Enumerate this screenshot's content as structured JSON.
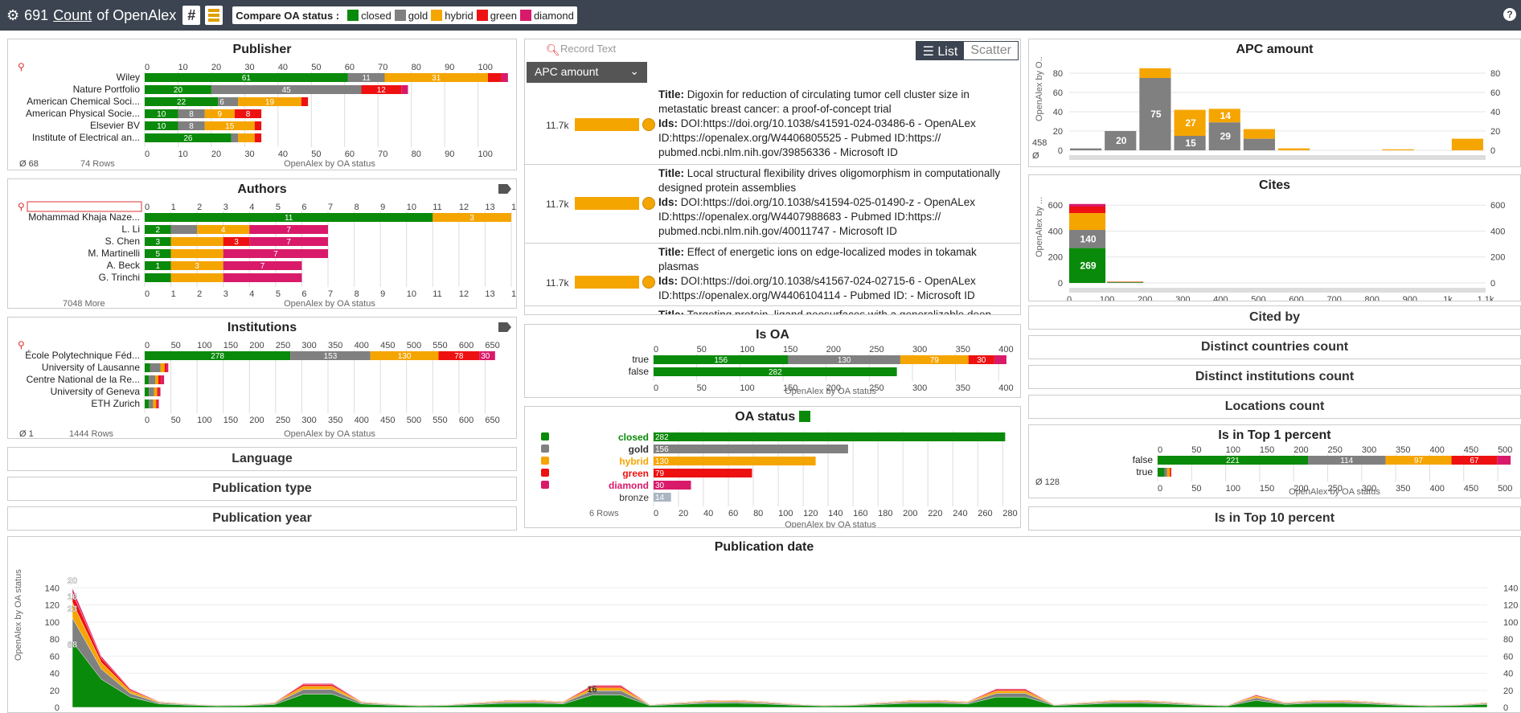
{
  "colors": {
    "closed": "#0a8a0a",
    "gold": "#808080",
    "hybrid": "#f5a500",
    "green": "#ee1111",
    "diamond": "#d91a6a",
    "bronze": "#aab4c2",
    "header": "#3b4450"
  },
  "topbar": {
    "count": "691",
    "count_label": "Count",
    "of_label": "of OpenAlex",
    "compare_label": "Compare OA status :",
    "legend": [
      "closed",
      "gold",
      "hybrid",
      "green",
      "diamond"
    ],
    "hash": "#"
  },
  "publisher": {
    "title": "Publisher",
    "ticks": [
      0,
      10,
      20,
      30,
      40,
      50,
      60,
      70,
      80,
      90,
      100
    ],
    "max": 110,
    "rows": [
      {
        "name": "Wiley",
        "segs": [
          61,
          11,
          31,
          4,
          2
        ]
      },
      {
        "name": "Nature Portfolio",
        "segs": [
          20,
          45,
          0,
          12,
          2
        ]
      },
      {
        "name": "American Chemical Soci...",
        "segs": [
          22,
          6,
          19,
          2,
          0
        ]
      },
      {
        "name": "American Physical Socie...",
        "segs": [
          10,
          8,
          9,
          8,
          0
        ]
      },
      {
        "name": "Elsevier BV",
        "segs": [
          10,
          8,
          15,
          2,
          0
        ]
      },
      {
        "name": "Institute of Electrical an...",
        "segs": [
          26,
          2,
          5,
          2,
          0
        ]
      }
    ],
    "footer_null": "68",
    "footer_rows": "74 Rows",
    "axis_note": "OpenAlex by OA status"
  },
  "authors": {
    "title": "Authors",
    "ticks": [
      0,
      1,
      2,
      3,
      4,
      5,
      6,
      7,
      8,
      9,
      10,
      11,
      12,
      13,
      14
    ],
    "max": 14,
    "rows": [
      {
        "name": "Mohammad Khaja Naze...",
        "segs": [
          11,
          0,
          3,
          0,
          0
        ]
      },
      {
        "name": "L. Li",
        "segs": [
          1,
          1,
          2,
          0,
          3
        ]
      },
      {
        "name": "S. Chen",
        "segs": [
          1,
          0,
          2,
          1,
          3
        ]
      },
      {
        "name": "M. Martinelli",
        "segs": [
          1,
          0,
          2,
          0,
          4
        ]
      },
      {
        "name": "A. Beck",
        "segs": [
          1,
          0,
          2,
          0,
          3
        ]
      },
      {
        "name": "G. Trinchi",
        "segs": [
          1,
          0,
          2,
          0,
          3
        ]
      }
    ],
    "labels": [
      [
        "11",
        "",
        "3",
        "",
        ""
      ],
      [
        "2",
        "",
        "4",
        "",
        "7"
      ],
      [
        "3",
        "",
        "",
        "3",
        "7"
      ],
      [
        "5",
        "",
        "",
        "",
        "7"
      ],
      [
        "1",
        "",
        "3",
        "",
        "7"
      ],
      [
        "",
        "",
        "",
        "",
        ""
      ]
    ],
    "footer_more": "7048 More",
    "axis_note": "OpenAlex by OA status"
  },
  "institutions": {
    "title": "Institutions",
    "ticks": [
      0,
      50,
      100,
      150,
      200,
      250,
      300,
      350,
      400,
      450,
      500,
      550,
      600,
      650
    ],
    "max": 700,
    "rows": [
      {
        "name": "École Polytechnique Féd...",
        "segs": [
          278,
          153,
          130,
          78,
          30
        ]
      },
      {
        "name": "University of Lausanne",
        "segs": [
          10,
          20,
          8,
          4,
          3
        ]
      },
      {
        "name": "Centre National de la Re...",
        "segs": [
          8,
          12,
          6,
          5,
          6
        ]
      },
      {
        "name": "University of Geneva",
        "segs": [
          8,
          10,
          6,
          3,
          3
        ]
      },
      {
        "name": "ETH Zurich",
        "segs": [
          8,
          8,
          6,
          3,
          2
        ]
      }
    ],
    "footer_null": "1",
    "footer_rows": "1444 Rows",
    "axis_note": "OpenAlex by OA status"
  },
  "collapsed_left": [
    "Language",
    "Publication type",
    "Publication year"
  ],
  "records": {
    "search_placeholder": "Record Text",
    "view_list": "List",
    "view_scatter": "Scatter",
    "sort_label": "APC amount",
    "items": [
      {
        "amount": "11.7k",
        "title": "Digoxin for reduction of circulating tumor cell cluster size in metastatic breast cancer: a proof-of-concept trial",
        "ids": "DOI:https://doi.org/10.1038/s41591-024-03486-6 - OpenALex ID:https://openalex.org/W4406805525 - Pubmed ID:https:// pubmed.ncbi.nlm.nih.gov/39856336 - Microsoft ID"
      },
      {
        "amount": "11.7k",
        "title": "Local structural flexibility drives oligomorphism in computationally designed protein assemblies",
        "ids": "DOI:https://doi.org/10.1038/s41594-025-01490-z - OpenALex ID:https://openalex.org/W4407988683 - Pubmed ID:https:// pubmed.ncbi.nlm.nih.gov/40011747 - Microsoft ID"
      },
      {
        "amount": "11.7k",
        "title": "Effect of energetic ions on edge-localized modes in tokamak plasmas",
        "ids": "DOI:https://doi.org/10.1038/s41567-024-02715-6 - OpenALex ID:https://openalex.org/W4406104114 - Pubmed ID: - Microsoft ID"
      },
      {
        "amount": "",
        "title": "Targeting protein–ligand neosurfaces with a generalizable deep",
        "ids": ""
      }
    ],
    "title_label": "Title:",
    "ids_label": "Ids:"
  },
  "is_oa": {
    "title": "Is OA",
    "ticks": [
      0,
      50,
      100,
      150,
      200,
      250,
      300,
      350,
      400
    ],
    "max": 410,
    "rows": [
      {
        "name": "true",
        "segs": [
          156,
          130,
          79,
          30,
          14
        ]
      },
      {
        "name": "false",
        "segs": [
          282,
          0,
          0,
          0,
          0
        ]
      }
    ],
    "axis_note": "OpenAlex by OA status"
  },
  "oa_status": {
    "title": "OA status",
    "ticks": [
      0,
      20,
      40,
      60,
      80,
      100,
      120,
      140,
      160,
      180,
      200,
      220,
      240,
      260,
      280
    ],
    "max": 285,
    "rows": [
      {
        "name": "closed",
        "value": 282,
        "color": "#0a8a0a"
      },
      {
        "name": "gold",
        "value": 156,
        "color": "#808080"
      },
      {
        "name": "hybrid",
        "value": 130,
        "color": "#f5a500"
      },
      {
        "name": "green",
        "value": 79,
        "color": "#ee1111"
      },
      {
        "name": "diamond",
        "value": 30,
        "color": "#d91a6a"
      },
      {
        "name": "bronze",
        "value": 14,
        "color": "#aab4c2"
      }
    ],
    "footer_rows": "6 Rows",
    "axis_note": "OpenAlex by OA status"
  },
  "apc": {
    "title": "APC amount",
    "yticks": [
      0,
      20,
      40,
      60,
      80
    ],
    "xticks": [
      "0",
      "1k",
      "2k",
      "3k",
      "4k",
      "5k",
      "6k",
      "7k",
      "8k",
      "9k",
      "10k",
      "11k",
      "12k"
    ],
    "null_count": "458",
    "ylabel": "OpenAlex by O..."
  },
  "cites": {
    "title": "Cites",
    "yticks": [
      0,
      200,
      400,
      600
    ],
    "xticks": [
      "0",
      "100",
      "200",
      "300",
      "400",
      "500",
      "600",
      "700",
      "800",
      "900",
      "1k",
      "1.1k"
    ],
    "ylabel": "OpenAlex by ..."
  },
  "collapsed_right": [
    "Cited by",
    "Distinct countries count",
    "Distinct institutions count",
    "Locations count"
  ],
  "top1": {
    "title": "Is in Top 1 percent",
    "ticks": [
      0,
      50,
      100,
      150,
      200,
      250,
      300,
      350,
      400,
      450,
      500
    ],
    "max": 520,
    "rows": [
      {
        "name": "false",
        "segs": [
          221,
          114,
          97,
          67,
          20
        ]
      },
      {
        "name": "true",
        "segs": [
          10,
          4,
          4,
          2,
          0
        ]
      }
    ],
    "footer_null": "128",
    "axis_note": "OpenAlex by OA status"
  },
  "top10_title": "Is in Top 10 percent",
  "pubdate": {
    "title": "Publication date",
    "yticks": [
      0,
      20,
      40,
      60,
      80,
      100,
      120,
      140
    ],
    "ylabel": "OpenAlex by OA status",
    "peak_labels": [
      "20",
      "16",
      "23",
      "88"
    ],
    "mid_label": "16"
  }
}
